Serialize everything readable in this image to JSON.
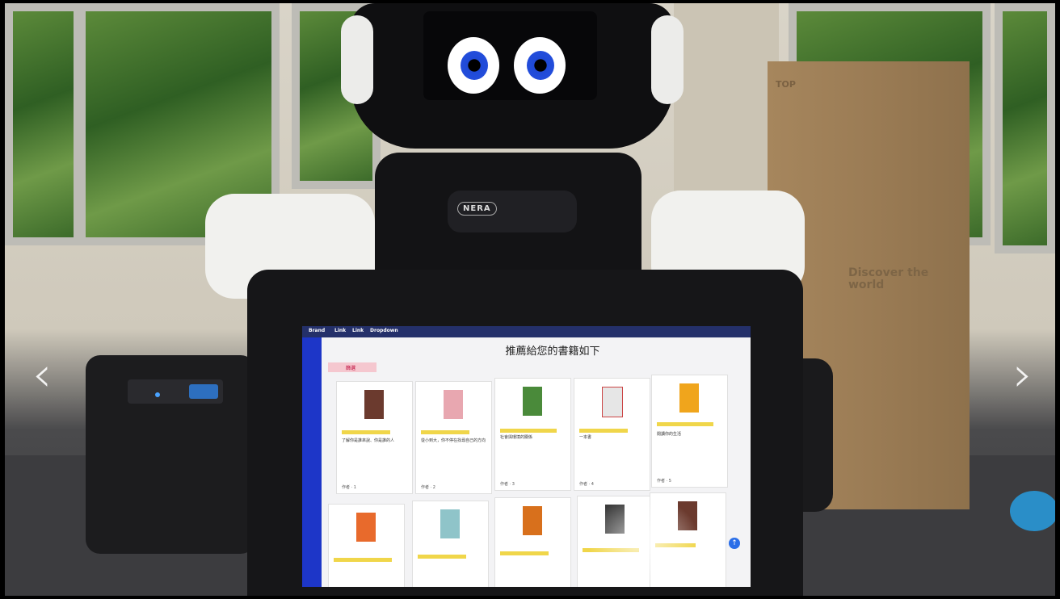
{
  "camera_brand": "NERA",
  "box": {
    "top_label": "TOP",
    "slogan": "Discover the world"
  },
  "screen": {
    "title": "推薦給您的書籍如下",
    "nav": [
      "Brand",
      "Link",
      "Link",
      "Dropdown"
    ],
    "filter_label": "篩選",
    "cards": [
      {
        "text": "了解你是誰來說、你是誰的人",
        "foot": "作者 · 1"
      },
      {
        "text": "從小到大，你不停在找尋自己的方向",
        "foot": "作者 · 2"
      },
      {
        "text": "社會與環境的關係",
        "foot": "作者 · 3"
      },
      {
        "text": "一本書",
        "foot": "作者 · 4"
      },
      {
        "text": "閱讀你的生活",
        "foot": "作者 · 5"
      },
      {
        "text": "",
        "foot": ""
      },
      {
        "text": "",
        "foot": ""
      },
      {
        "text": "",
        "foot": ""
      },
      {
        "text": "",
        "foot": ""
      },
      {
        "text": "",
        "foot": ""
      }
    ]
  },
  "icons": {
    "left_arrow": "chevron-left-icon",
    "right_arrow": "chevron-right-icon",
    "scroll_top": "arrow-up-icon"
  },
  "colors": {
    "robot_eye": "#2650e0",
    "screen_sidebar": "#1d36c8",
    "screen_navbar": "#24306a",
    "tag": "#f0d64a"
  }
}
